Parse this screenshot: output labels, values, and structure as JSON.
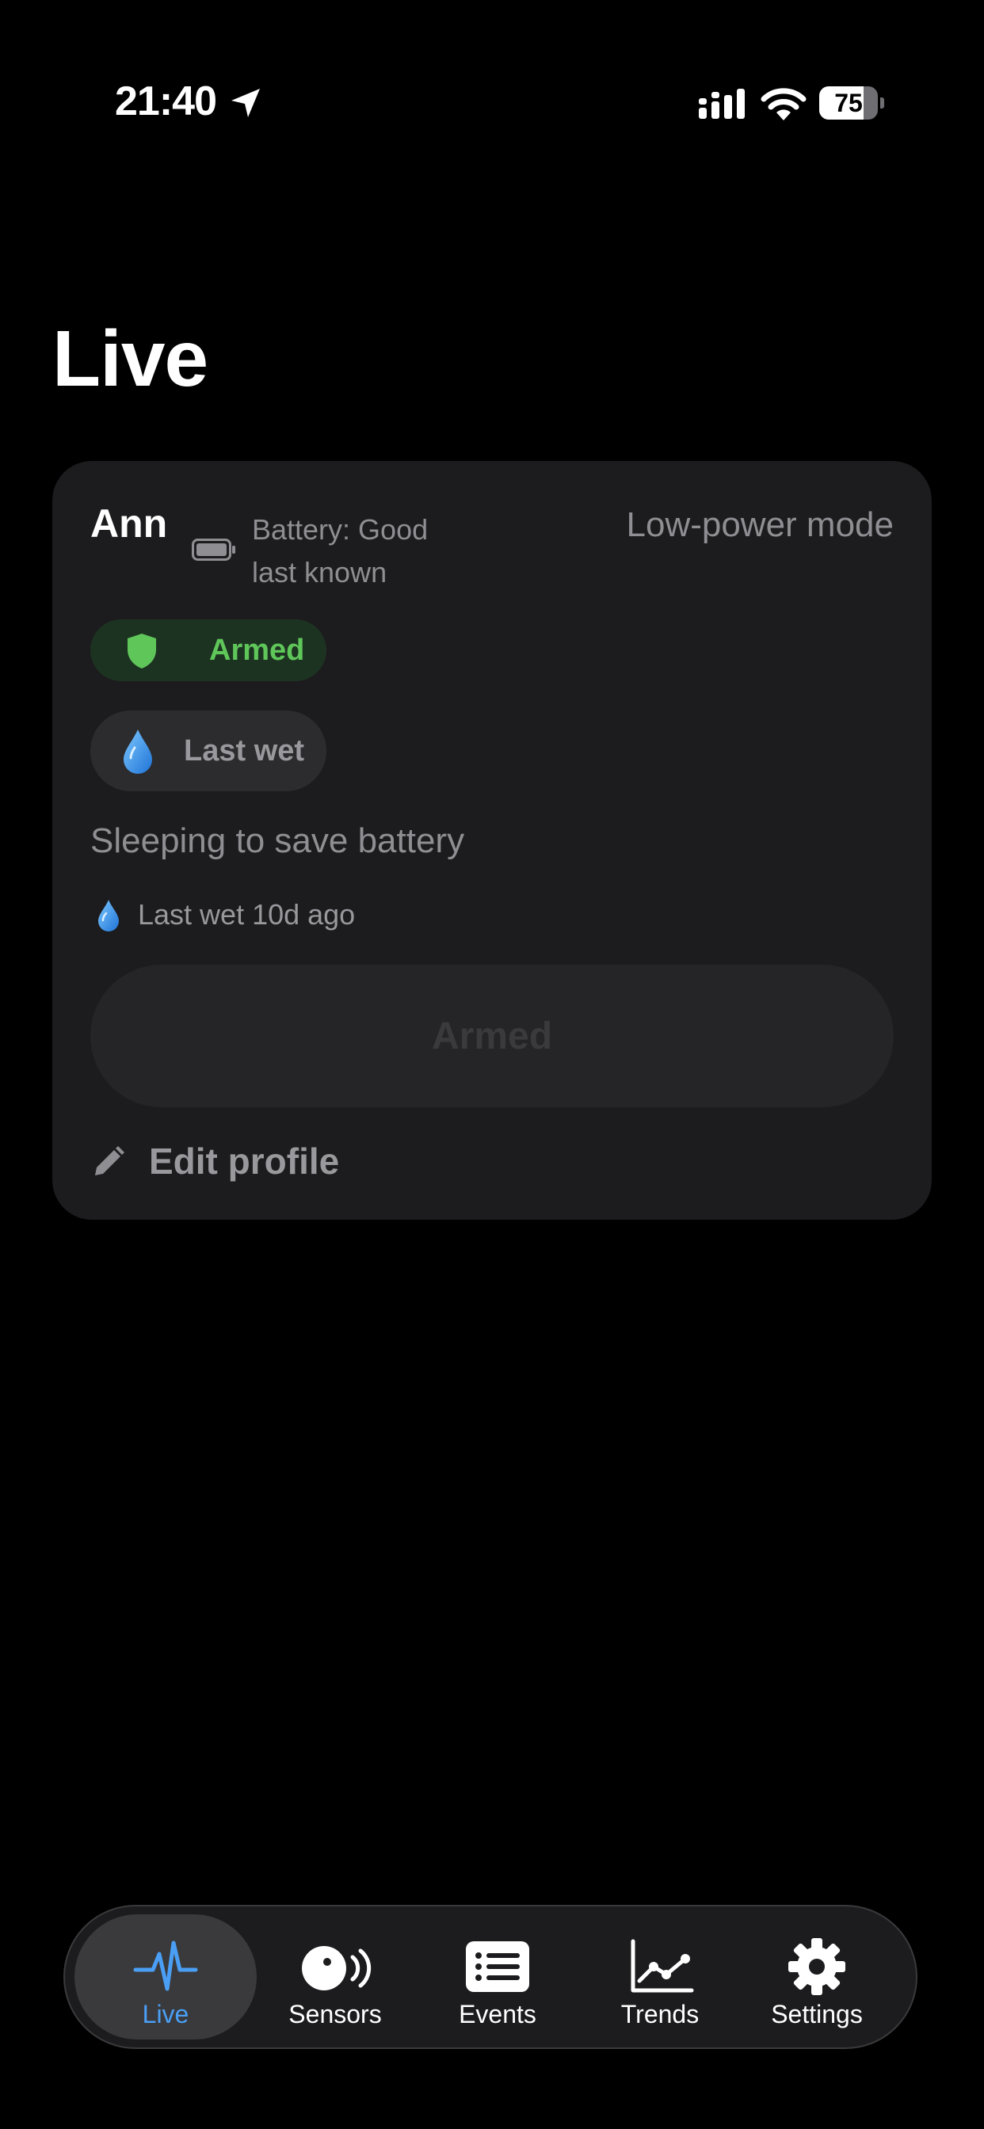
{
  "status_bar": {
    "time": "21:40",
    "battery_percent": 75,
    "battery_label": "75"
  },
  "page": {
    "title": "Live"
  },
  "profile_card": {
    "name": "Ann",
    "battery_line1": "Battery: Good",
    "battery_line2": "last known",
    "mode": "Low-power mode",
    "armed_pill_label": "Armed",
    "last_wet_pill_label": "Last wet",
    "sleeping_text": "Sleeping to save battery",
    "last_wet_text": "Last wet 10d ago",
    "armed_button_label": "Armed",
    "edit_profile_label": "Edit profile"
  },
  "colors": {
    "accent_blue": "#4a9ff5",
    "armed_green": "#5fc65a",
    "card_bg": "#1c1c1e"
  },
  "tab_bar": {
    "active_tab": "Live",
    "tabs": [
      {
        "label": "Live",
        "icon": "waveform-icon"
      },
      {
        "label": "Sensors",
        "icon": "sensor-icon"
      },
      {
        "label": "Events",
        "icon": "list-icon"
      },
      {
        "label": "Trends",
        "icon": "trend-chart-icon"
      },
      {
        "label": "Settings",
        "icon": "gear-icon"
      }
    ]
  }
}
